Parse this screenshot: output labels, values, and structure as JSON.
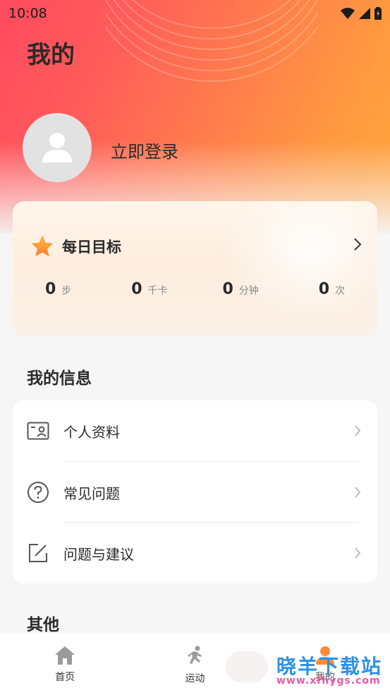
{
  "status_bar": {
    "time": "10:08"
  },
  "page": {
    "title": "我的"
  },
  "profile": {
    "login_label": "立即登录"
  },
  "daily_goal": {
    "title": "每日目标",
    "stats": [
      {
        "value": "0",
        "unit": "步"
      },
      {
        "value": "0",
        "unit": "千卡"
      },
      {
        "value": "0",
        "unit": "分钟"
      },
      {
        "value": "0",
        "unit": "次"
      }
    ]
  },
  "my_info": {
    "title": "我的信息",
    "items": [
      {
        "label": "个人资料",
        "icon": "profile-card-icon"
      },
      {
        "label": "常见问题",
        "icon": "question-circle-icon"
      },
      {
        "label": "问题与建议",
        "icon": "edit-note-icon"
      }
    ]
  },
  "other": {
    "title": "其他"
  },
  "tabbar": {
    "tabs": [
      {
        "label": "首页",
        "icon": "home-icon"
      },
      {
        "label": "运动",
        "icon": "running-icon"
      },
      {
        "label": "我的",
        "icon": "profile-icon"
      }
    ]
  },
  "watermark": {
    "top": "晓羊下载站",
    "bottom": "www.xfhygs.com"
  },
  "colors": {
    "accent_start": "#ff4a5f",
    "accent_end": "#ffa43c",
    "background": "#f6f6f6"
  }
}
